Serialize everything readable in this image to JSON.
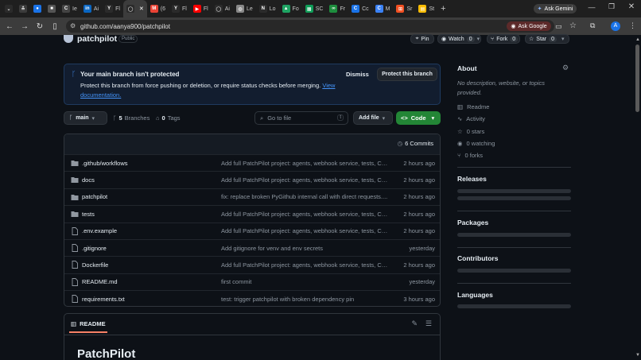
{
  "browser": {
    "tabs": [
      {
        "label": "",
        "icon": "chevron-down-icon",
        "color": "#2b2b2b",
        "glyph": "⌄"
      },
      {
        "label": "",
        "icon": "bolt-icon",
        "color": "#3b3b3b",
        "glyph": "≛"
      },
      {
        "label": "",
        "icon": "blue-circle-icon",
        "color": "#1a73e8",
        "glyph": "●"
      },
      {
        "label": "",
        "icon": "app-icon",
        "color": "#555",
        "glyph": "■"
      },
      {
        "label": "Ie",
        "icon": "cc-icon",
        "color": "#444",
        "glyph": "C"
      },
      {
        "label": "Ai",
        "icon": "linkedin-icon",
        "color": "#0a66c2",
        "glyph": "in"
      },
      {
        "label": "Fl",
        "icon": "y-icon",
        "color": "#2b2b2b",
        "glyph": "Y"
      },
      {
        "label": "",
        "icon": "github-icon",
        "color": "#fff",
        "glyph": "◯",
        "active": true
      },
      {
        "label": "(6",
        "icon": "gmail-icon",
        "color": "#ea4335",
        "glyph": "M"
      },
      {
        "label": "Fl",
        "icon": "y-icon",
        "color": "#2b2b2b",
        "glyph": "Y"
      },
      {
        "label": "Fl",
        "icon": "youtube-icon",
        "color": "#ff0000",
        "glyph": "▶"
      },
      {
        "label": "Ai",
        "icon": "github-icon",
        "color": "#fff",
        "glyph": "◯"
      },
      {
        "label": "Le",
        "icon": "globe-icon",
        "color": "#888",
        "glyph": "◍"
      },
      {
        "label": "Lo",
        "icon": "notion-icon",
        "color": "#fff",
        "glyph": "N"
      },
      {
        "label": "Fo",
        "icon": "drive-icon",
        "color": "#1fa463",
        "glyph": "▲"
      },
      {
        "label": "SC",
        "icon": "sheets-icon",
        "color": "#0f9d58",
        "glyph": "▦"
      },
      {
        "label": "Fr",
        "icon": "link-icon",
        "color": "#1e8e3e",
        "glyph": "∞"
      },
      {
        "label": "Cc",
        "icon": "c-icon",
        "color": "#1a73e8",
        "glyph": "C"
      },
      {
        "label": "M",
        "icon": "c-icon",
        "color": "#3b82f6",
        "glyph": "C"
      },
      {
        "label": "Sr",
        "icon": "windows-icon",
        "color": "#f25022",
        "glyph": "⊞"
      },
      {
        "label": "St",
        "icon": "notes-icon",
        "color": "#fbbc04",
        "glyph": "▤"
      }
    ],
    "new_tab": "+",
    "ask_gemini": "Ask Gemini",
    "url": "github.com/aanya900/patchpilot",
    "ask_google": "Ask Google"
  },
  "repo": {
    "name": "patchpilot",
    "visibility": "Public",
    "pin": "Pin",
    "watch": "Watch",
    "watch_count": "0",
    "fork": "Fork",
    "fork_count": "0",
    "star": "Star",
    "star_count": "0"
  },
  "banner": {
    "title": "Your main branch isn't protected",
    "body": "Protect this branch from force pushing or deletion, or require status checks before merging.",
    "link": "View documentation.",
    "dismiss": "Dismiss",
    "protect": "Protect this branch"
  },
  "nav": {
    "branch": "main",
    "branches_count": "5",
    "branches_label": "Branches",
    "tags_count": "0",
    "tags_label": "Tags",
    "go_to_file": "Go to file",
    "shortcut": "t",
    "add_file": "Add file",
    "code": "Code"
  },
  "commits": {
    "count": "6 Commits"
  },
  "files": [
    {
      "name": ".github/workflows",
      "type": "folder",
      "message": "Add full PatchPilot project: agents, webhook service, tests, CI ...",
      "date": "2 hours ago"
    },
    {
      "name": "docs",
      "type": "folder",
      "message": "Add full PatchPilot project: agents, webhook service, tests, CI ...",
      "date": "2 hours ago"
    },
    {
      "name": "patchpilot",
      "type": "folder",
      "message": "fix: replace broken PyGithub internal call with direct requests....",
      "date": "2 hours ago"
    },
    {
      "name": "tests",
      "type": "folder",
      "message": "Add full PatchPilot project: agents, webhook service, tests, CI ...",
      "date": "2 hours ago"
    },
    {
      "name": ".env.example",
      "type": "file",
      "message": "Add full PatchPilot project: agents, webhook service, tests, CI ...",
      "date": "2 hours ago"
    },
    {
      "name": ".gitignore",
      "type": "file",
      "message": "Add gitignore for venv and env secrets",
      "date": "yesterday"
    },
    {
      "name": "Dockerfile",
      "type": "file",
      "message": "Add full PatchPilot project: agents, webhook service, tests, CI ...",
      "date": "2 hours ago"
    },
    {
      "name": "README.md",
      "type": "file",
      "message": "first commit",
      "date": "yesterday"
    },
    {
      "name": "requirements.txt",
      "type": "file",
      "message": "test: trigger patchpilot with broken dependency pin",
      "date": "3 hours ago"
    }
  ],
  "readme": {
    "tab": "README",
    "heading": "PatchPilot"
  },
  "about": {
    "title": "About",
    "description": "No description, website, or topics provided.",
    "readme": "Readme",
    "activity": "Activity",
    "stars": "0 stars",
    "watching": "0 watching",
    "forks": "0 forks"
  },
  "sections": {
    "releases": "Releases",
    "packages": "Packages",
    "contributors": "Contributors",
    "languages": "Languages"
  }
}
